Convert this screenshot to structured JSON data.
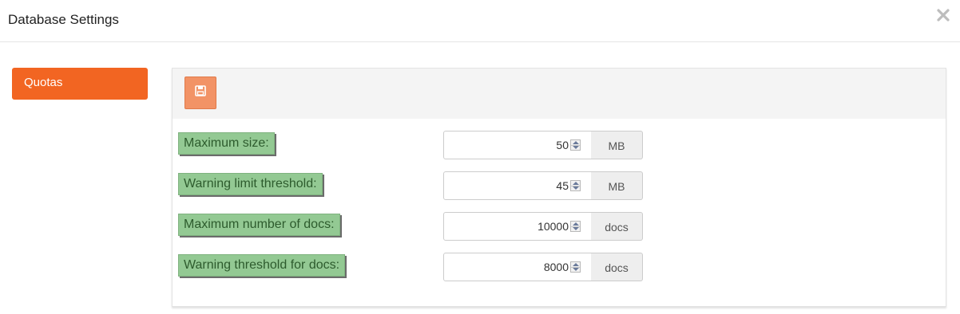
{
  "dialog": {
    "title": "Database Settings",
    "close_icon": "close-icon"
  },
  "sidebar": {
    "items": [
      {
        "label": "Quotas",
        "active": true
      }
    ],
    "accent_color": "#f26522"
  },
  "toolbar": {
    "save_icon": "save-icon",
    "save_color": "#f29366"
  },
  "form": {
    "label_color": "#93c993",
    "rows": [
      {
        "label": "Maximum size:",
        "value": "50",
        "unit": "MB"
      },
      {
        "label": "Warning limit threshold:",
        "value": "45",
        "unit": "MB"
      },
      {
        "label": "Maximum number of docs:",
        "value": "10000",
        "unit": "docs"
      },
      {
        "label": "Warning threshold for docs:",
        "value": "8000",
        "unit": "docs"
      }
    ]
  }
}
